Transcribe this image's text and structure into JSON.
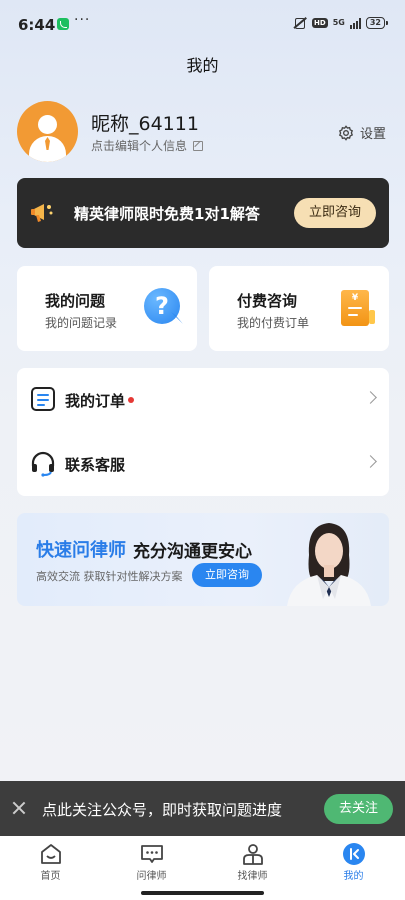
{
  "status_bar": {
    "time": "6:44",
    "network": "5G",
    "battery": "32"
  },
  "page": {
    "title": "我的"
  },
  "profile": {
    "nickname": "昵称_64111",
    "edit_hint": "点击编辑个人信息",
    "settings_label": "设置"
  },
  "promo": {
    "text": "精英律师限时免费1对1解答",
    "button": "立即咨询"
  },
  "cards": [
    {
      "title": "我的问题",
      "subtitle": "我的问题记录"
    },
    {
      "title": "付费咨询",
      "subtitle": "我的付费订单"
    }
  ],
  "list": [
    {
      "label": "我的订单",
      "has_badge": true
    },
    {
      "label": "联系客服"
    }
  ],
  "lawyer_banner": {
    "title_highlight": "快速问律师",
    "title_rest": "充分沟通更安心",
    "subtitle": "高效交流   获取针对性解决方案",
    "button": "立即咨询"
  },
  "follow_bar": {
    "text": "点此关注公众号，即时获取问题进度",
    "button": "去关注"
  },
  "bottom_nav": [
    {
      "label": "首页"
    },
    {
      "label": "问律师"
    },
    {
      "label": "找律师"
    },
    {
      "label": "我的",
      "active": true
    }
  ],
  "colors": {
    "accent": "#2a86f0",
    "avatar_bg": "#f29a34",
    "promo_bg": "#2b2b2b",
    "promo_button": "#f6dfb4",
    "follow_button": "#4fb873",
    "badge": "#e53935"
  }
}
